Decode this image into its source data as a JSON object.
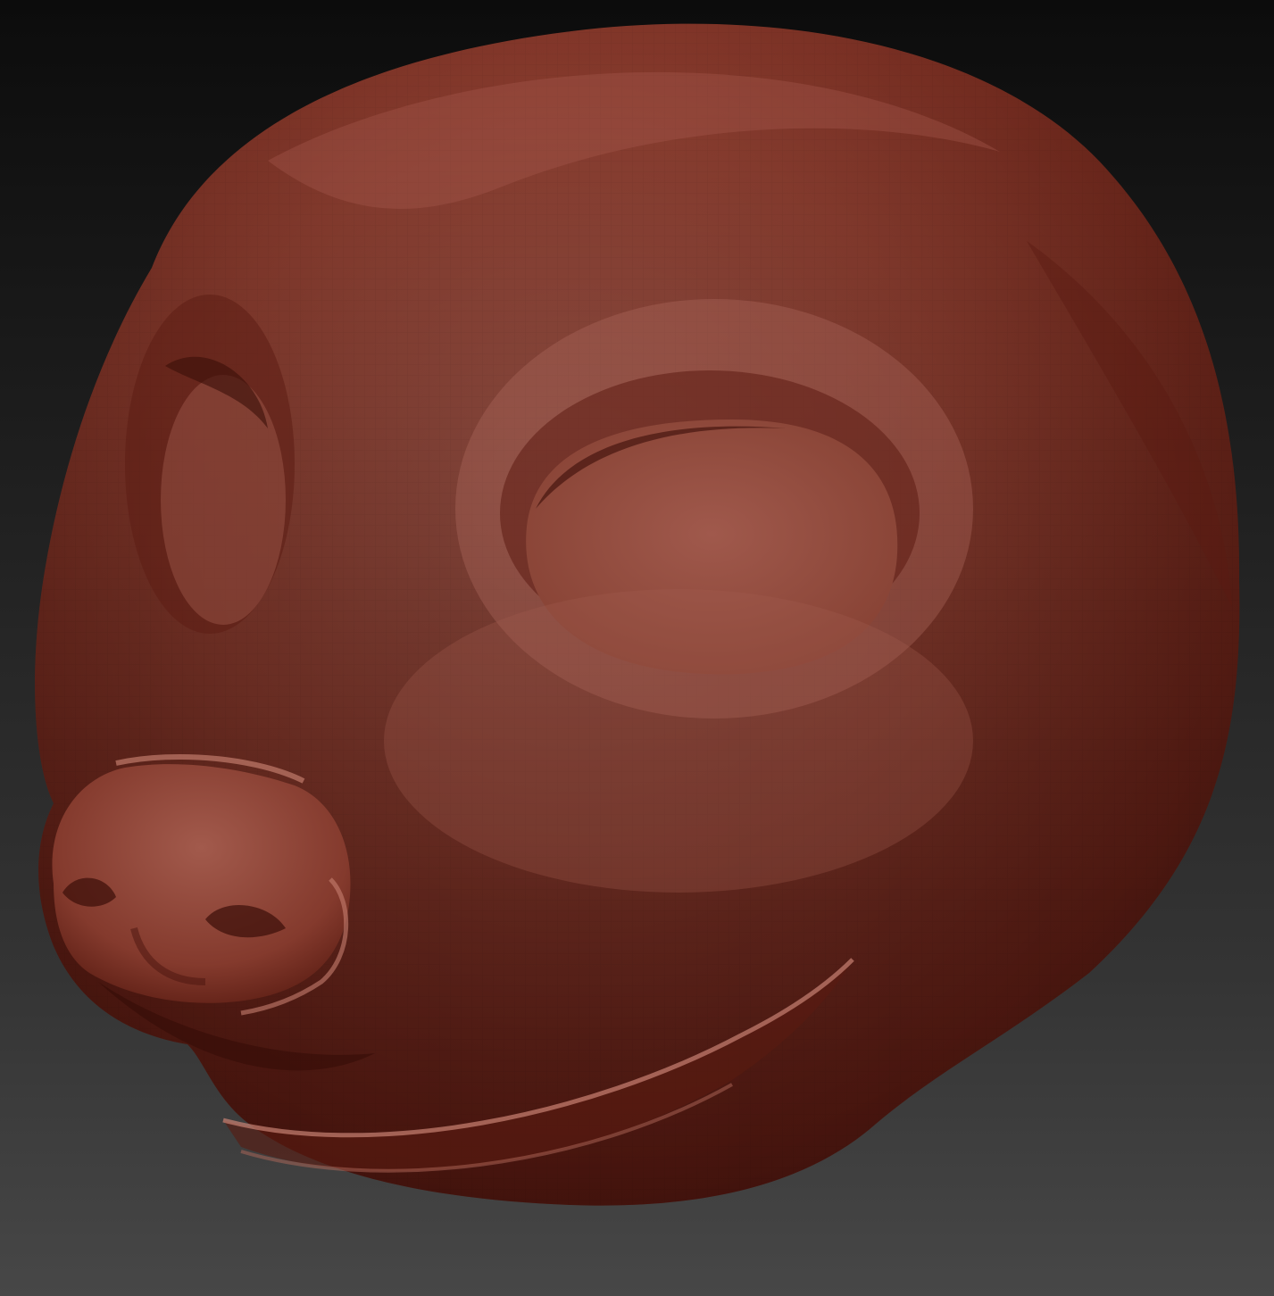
{
  "scene": {
    "subject": "sculpted-animal-head",
    "material_color": "#8a3a2c",
    "highlight_color": "#b0665a",
    "shadow_color": "#3a120c",
    "background_top": "#0c0c0c",
    "background_bottom": "#474747"
  }
}
